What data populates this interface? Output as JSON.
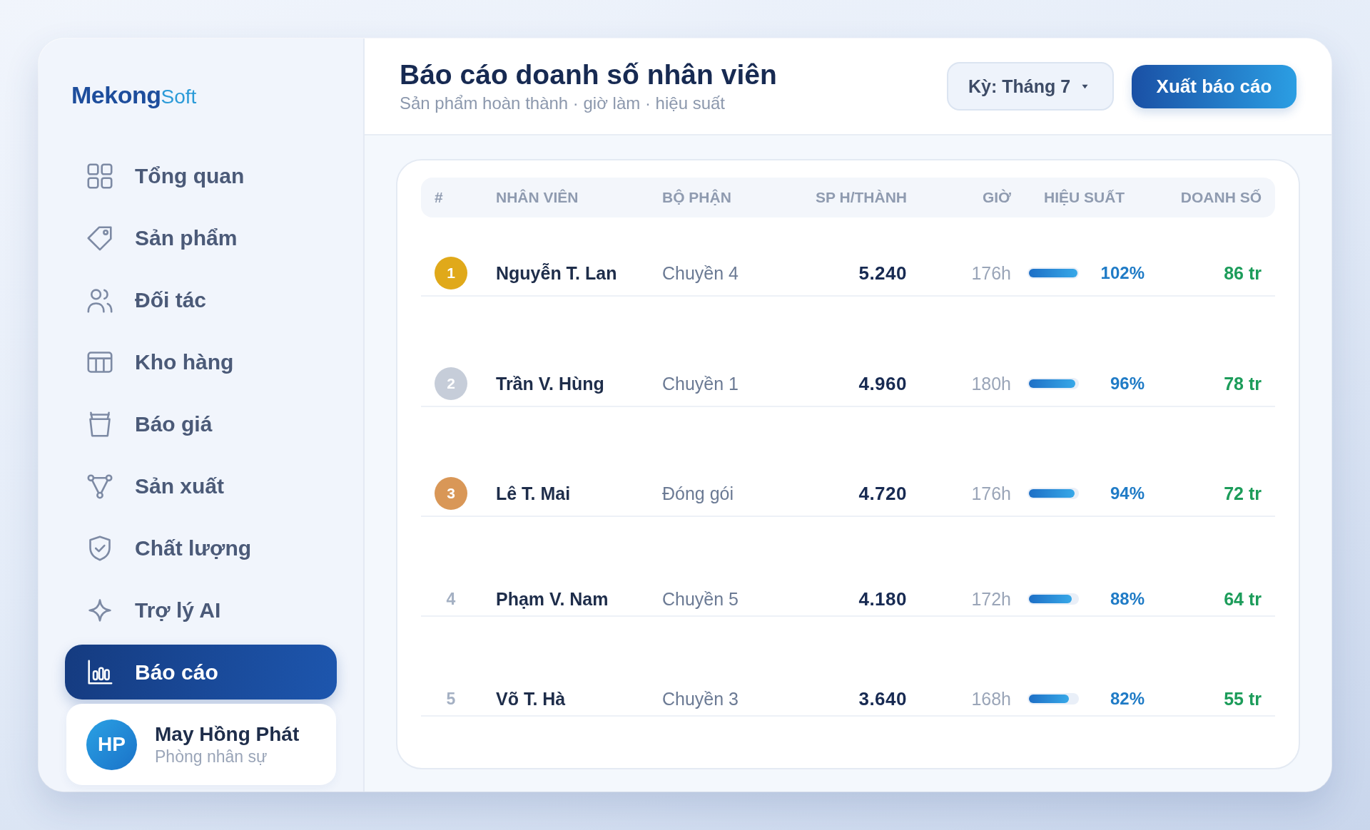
{
  "brand": {
    "name": "Mekong",
    "suffix": "Soft"
  },
  "sidebar": {
    "items": [
      {
        "label": "Tổng quan",
        "selected": false
      },
      {
        "label": "Sản phẩm",
        "selected": false
      },
      {
        "label": "Đối tác",
        "selected": false
      },
      {
        "label": "Kho hàng",
        "selected": false
      },
      {
        "label": "Báo giá",
        "selected": false
      },
      {
        "label": "Sản xuất",
        "selected": false
      },
      {
        "label": "Chất lượng",
        "selected": false
      },
      {
        "label": "Trợ lý AI",
        "selected": false
      },
      {
        "label": "Báo cáo",
        "selected": true
      }
    ],
    "user": {
      "initials": "HP",
      "name": "May Hồng Phát",
      "role": "Phòng nhân sự"
    }
  },
  "header": {
    "title": "Báo cáo doanh số nhân viên",
    "subtitle": "Sản phẩm hoàn thành · giờ làm · hiệu suất",
    "period_select": {
      "value": "Kỳ: Tháng 7"
    },
    "export_button": "Xuất báo cáo"
  },
  "table": {
    "columns": [
      "#",
      "NHÂN VIÊN",
      "BỘ PHẬN",
      "SP H/THÀNH",
      "GIỜ",
      "HIỆU SUẤT",
      "DOANH SỐ"
    ],
    "rows": [
      {
        "kind": "medal",
        "rank": "1",
        "color": "#e0a91a",
        "name": "Nguyễn T. Lan",
        "department": "Chuyền 4",
        "units": "5.240",
        "hours": "176h",
        "level": 1.0,
        "efficiency": "102%",
        "revenue": "86 tr"
      },
      {
        "kind": "medal",
        "rank": "2",
        "color": "#c6cdd9",
        "name": "Trần V. Hùng",
        "department": "Chuyền 1",
        "units": "4.960",
        "hours": "180h",
        "level": 0.96,
        "efficiency": "96%",
        "revenue": "78 tr"
      },
      {
        "kind": "medal",
        "rank": "3",
        "color": "#d99757",
        "name": "Lê T. Mai",
        "department": "Đóng gói",
        "units": "4.720",
        "hours": "176h",
        "level": 0.94,
        "efficiency": "94%",
        "revenue": "72 tr"
      },
      {
        "kind": "plain",
        "rank": "4",
        "name": "Phạm V. Nam",
        "department": "Chuyền 5",
        "units": "4.180",
        "hours": "172h",
        "level": 0.88,
        "efficiency": "88%",
        "revenue": "64 tr"
      },
      {
        "kind": "plain",
        "rank": "5",
        "name": "Võ T. Hà",
        "department": "Chuyền 3",
        "units": "3.640",
        "hours": "168h",
        "level": 0.82,
        "efficiency": "82%",
        "revenue": "55 tr"
      }
    ]
  }
}
